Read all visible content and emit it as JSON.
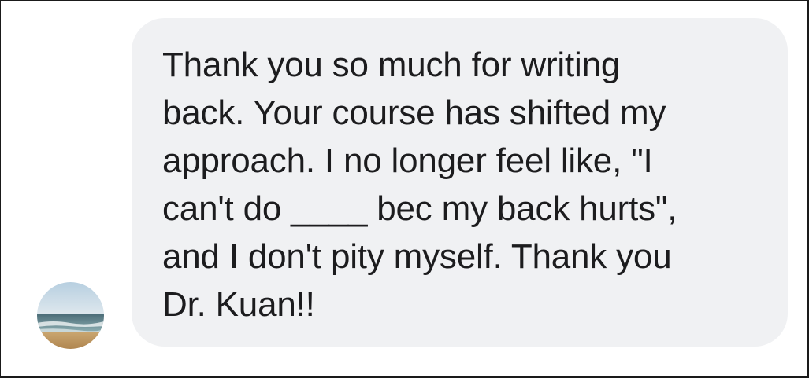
{
  "message": {
    "text": "Thank you so much for writing\nback. Your course has shifted my\napproach. I no longer feel like, \"I\ncan't do ____  bec my back hurts\",\nand I don't pity myself. Thank you\nDr. Kuan!!",
    "bubble_color": "#f0f1f3",
    "text_color": "#1c1c1e"
  },
  "sender": {
    "avatar_icon": "beach-photo-avatar"
  }
}
